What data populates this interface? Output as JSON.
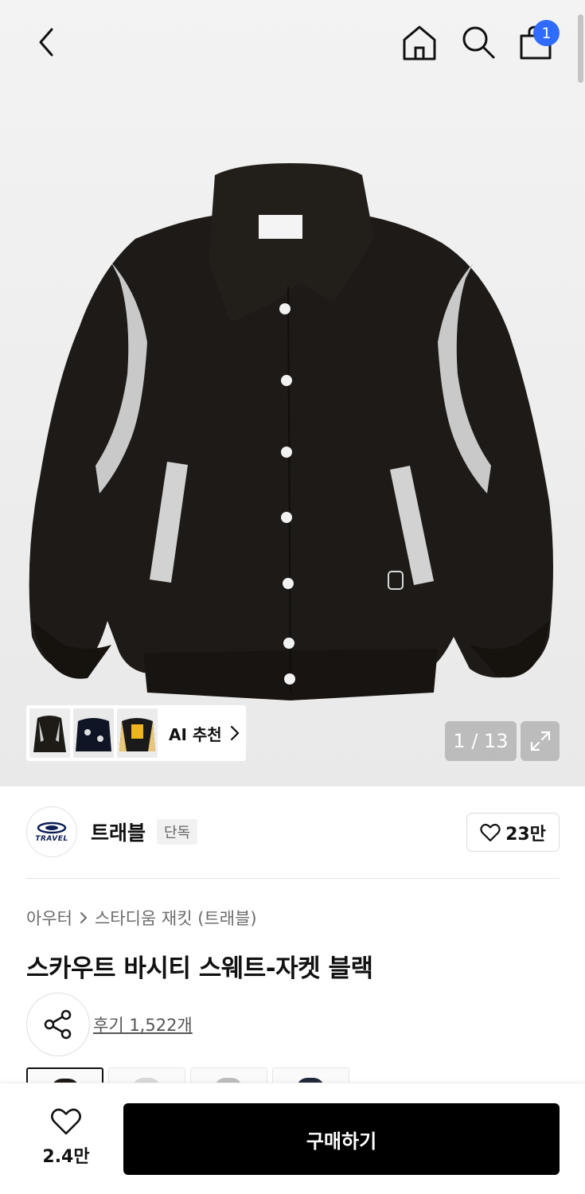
{
  "header": {
    "cart_count": "1"
  },
  "gallery": {
    "counter": "1 / 13",
    "ai_label": "AI 추천"
  },
  "brand": {
    "logo_text": "TRAVEL",
    "name": "트래블",
    "badge": "단독",
    "likes": "23만"
  },
  "breadcrumb": {
    "category": "아우터",
    "subcategory": "스타디움 재킷 (트래블)"
  },
  "product": {
    "title": "스카우트 바시티 스웨트-자켓 블랙",
    "reviews": "후기 1,522개"
  },
  "bottom_bar": {
    "wish_count": "2.4만",
    "buy_label": "구매하기"
  },
  "colors": {
    "badge": "#2f6bff",
    "button": "#000000",
    "jacket": "#1d1a17"
  }
}
